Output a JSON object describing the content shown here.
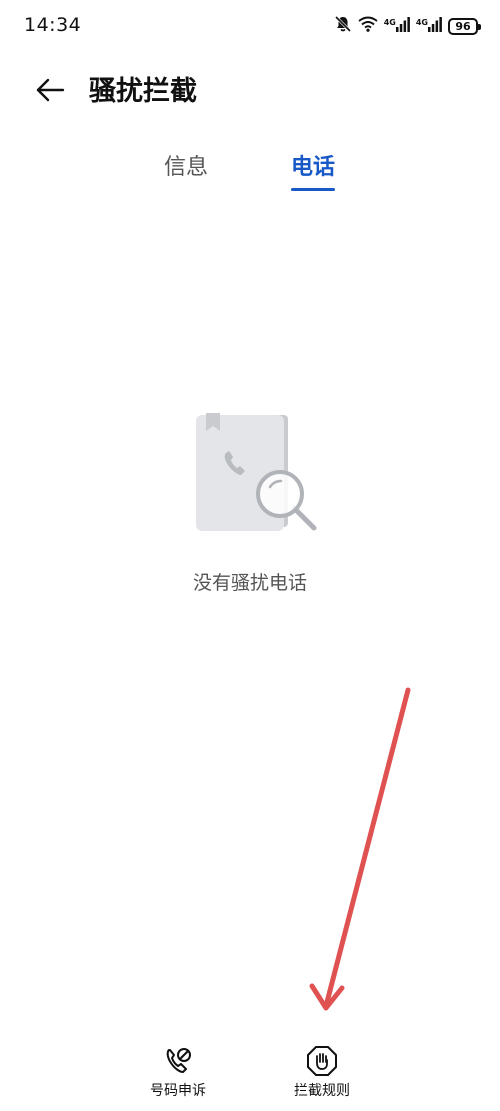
{
  "status_bar": {
    "time": "14:34",
    "network_1": "4G",
    "network_2": "4G",
    "battery": "96",
    "icons": [
      "mute-bell-icon",
      "wifi-icon",
      "signal-icon",
      "signal-icon",
      "battery-icon"
    ]
  },
  "header": {
    "title": "骚扰拦截",
    "back_icon": "back-arrow-icon"
  },
  "tabs": [
    {
      "label": "信息",
      "active": false
    },
    {
      "label": "电话",
      "active": true
    }
  ],
  "empty_state": {
    "icon": "phonebook-search-icon",
    "message": "没有骚扰电话"
  },
  "bottom_actions": [
    {
      "label": "号码申诉",
      "icon": "phone-block-icon"
    },
    {
      "label": "拦截规则",
      "icon": "hand-stop-icon"
    }
  ],
  "colors": {
    "accent": "#1858c7",
    "annotation_arrow": "#e05252"
  }
}
